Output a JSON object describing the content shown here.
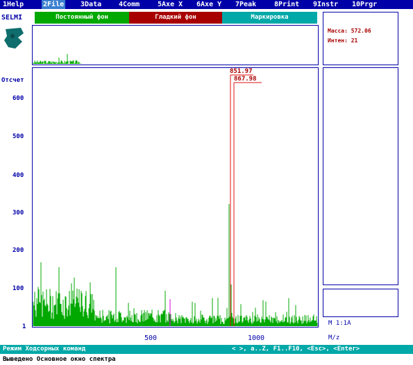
{
  "menu": [
    {
      "key": "1",
      "label": "Help"
    },
    {
      "key": "2",
      "label": "File"
    },
    {
      "key": "3",
      "label": "Data"
    },
    {
      "key": "4",
      "label": "Comm"
    },
    {
      "key": "5",
      "label": "Axe X"
    },
    {
      "key": "6",
      "label": "Axe Y"
    },
    {
      "key": "7",
      "label": "Peak"
    },
    {
      "key": "8",
      "label": "Print"
    },
    {
      "key": "9",
      "label": "Instr"
    },
    {
      "key": "10",
      "label": "Prgr"
    }
  ],
  "logo": "SELMI",
  "tabs": [
    {
      "label": "Постоянный фон",
      "color": "#00a800"
    },
    {
      "label": "Гладкий фон",
      "color": "#a80000"
    },
    {
      "label": "Маркировка",
      "color": "#00a8a8"
    }
  ],
  "info": {
    "mass_label": "Масса:",
    "mass_value": "572.06",
    "intensity_label": "Интен:",
    "intensity_value": "21"
  },
  "y_axis": {
    "unit": "Отсчет",
    "ticks": [
      "600",
      "500",
      "400",
      "300",
      "200",
      "100",
      "1"
    ]
  },
  "x_axis": {
    "unit": "M/z",
    "ticks": [
      "500",
      "1000"
    ]
  },
  "scale_label": "M 1:1A",
  "peak_labels": [
    "851.97",
    "867.98"
  ],
  "status": {
    "mode": "Режим Ходсорных команд",
    "keys": "< >, a..Z, F1..F10, <Esc>, <Enter>"
  },
  "message": "Выведено Основное окно спектра",
  "colors": {
    "menu": "#0000a8",
    "spectrum": "#00a800",
    "marker": "#e000e0",
    "peak_line": "#e01010"
  }
}
